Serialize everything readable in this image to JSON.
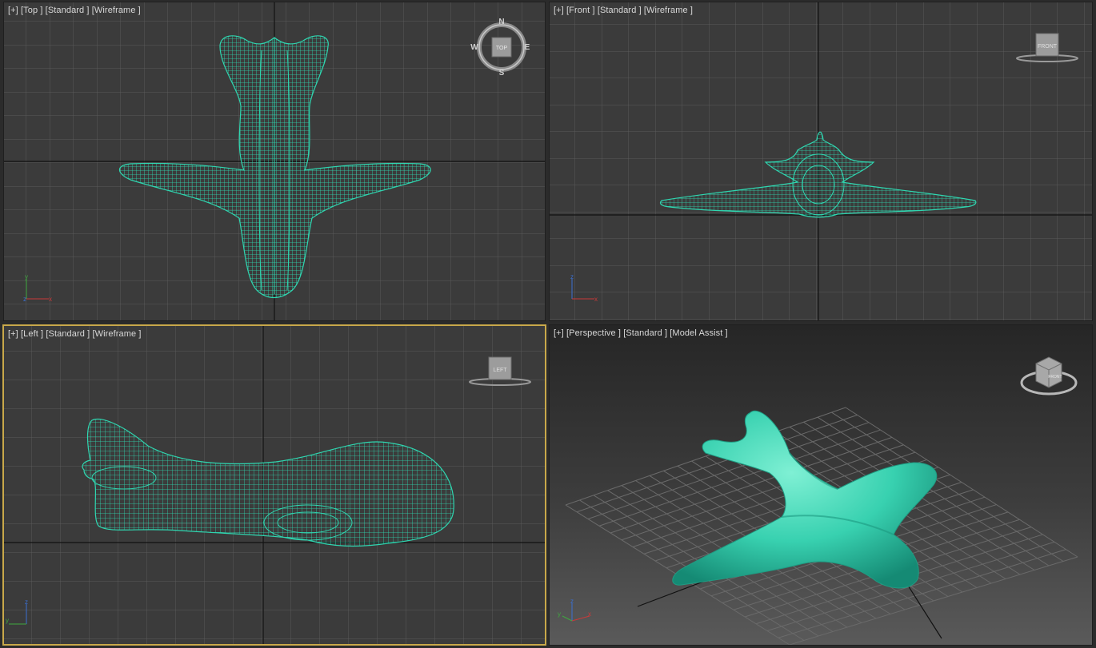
{
  "viewports": {
    "top": {
      "menu": "[+]",
      "view": "[Top ]",
      "shading": "[Standard ]",
      "style": "[Wireframe ]",
      "nav": {
        "cube_label": "TOP",
        "n": "N",
        "s": "S",
        "e": "E",
        "w": "W",
        "icon": "viewcube-compass-icon"
      },
      "axes": {
        "a": "y",
        "b": "x",
        "origin": "z"
      }
    },
    "front": {
      "menu": "[+]",
      "view": "[Front ]",
      "shading": "[Standard ]",
      "style": "[Wireframe ]",
      "nav": {
        "cube_label": "FRONT",
        "icon": "viewcube-icon"
      },
      "axes": {
        "a": "z",
        "b": "x"
      }
    },
    "left": {
      "menu": "[+]",
      "view": "[Left ]",
      "shading": "[Standard ]",
      "style": "[Wireframe ]",
      "nav": {
        "cube_label": "LEFT",
        "icon": "viewcube-icon"
      },
      "axes": {
        "a": "z",
        "b": "y"
      }
    },
    "perspective": {
      "menu": "[+]",
      "view": "[Perspective ]",
      "shading": "[Standard ]",
      "style": "[Model Assist ]",
      "nav": {
        "cube_label": "FRONT",
        "icon": "viewcube-3d-icon"
      },
      "axes": {
        "a": "z",
        "b": "x",
        "c": "y"
      }
    }
  },
  "colors": {
    "model": "#2fd6b0",
    "viewport_bg": "#3b3b3b",
    "grid": "#5a5a5a",
    "active_border": "#c8a84a"
  }
}
